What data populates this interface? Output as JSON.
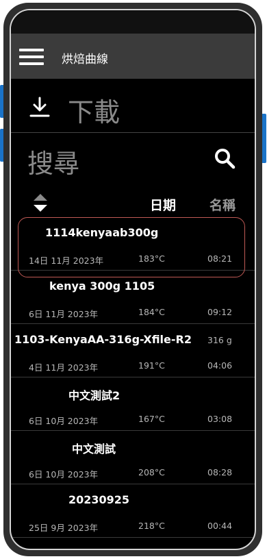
{
  "app": {
    "title": "烘焙曲線"
  },
  "actions": {
    "download_label": "下載",
    "search_label": "搜尋"
  },
  "sort": {
    "date_header": "日期",
    "name_header": "名稱"
  },
  "roasts": [
    {
      "name": "1114kenyaab300g",
      "date": "14日 11月 2023年",
      "temp": "183°C",
      "time": "08:21",
      "weight": ""
    },
    {
      "name": "kenya 300g 1105",
      "date": "6日 11月 2023年",
      "temp": "184°C",
      "time": "09:12",
      "weight": ""
    },
    {
      "name": "1103-KenyaAA-316g-Xfile-R2",
      "date": "4日 11月 2023年",
      "temp": "191°C",
      "time": "04:06",
      "weight": "316 g"
    },
    {
      "name": "中文測試2",
      "date": "6日 10月 2023年",
      "temp": "167°C",
      "time": "03:08",
      "weight": ""
    },
    {
      "name": "中文測試",
      "date": "6日 10月 2023年",
      "temp": "208°C",
      "time": "08:28",
      "weight": ""
    },
    {
      "name": "20230925",
      "date": "25日 9月 2023年",
      "temp": "218°C",
      "time": "00:44",
      "weight": ""
    }
  ],
  "colors": {
    "highlight": "#c05a55",
    "side_button": "#1a73c8"
  }
}
